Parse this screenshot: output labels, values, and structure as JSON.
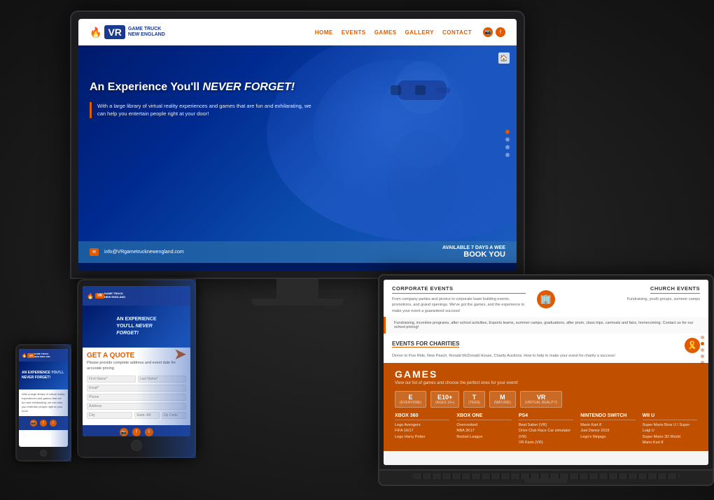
{
  "brand": {
    "name": "VR Game Truck New England",
    "logo_vr": "VR",
    "logo_tagline1": "GAME TRUCK",
    "logo_tagline2": "NEW ENGLAND"
  },
  "nav": {
    "links": [
      "HOME",
      "EVENTS",
      "GAMES",
      "GALLERY",
      "CONTACT"
    ]
  },
  "hero": {
    "title_prefix": "An Experience You'll ",
    "title_emphasis": "NEVER FORGET!",
    "body": "With a large library of virtual reality experiences and games that are fun and exhilarating, we can help you entertain people right at your door!"
  },
  "footer_bar": {
    "email": "info@VRgametrucknewengland.com",
    "available": "AVAILABLE 7 DAYS A WEE",
    "book": "BOOK YOU"
  },
  "events": {
    "corporate": {
      "title": "CORPORATE EVENTS",
      "text": "From company parties and picnics to corporate team building events, promotions, and grand openings.\n\nWe've got the games, and the experience to make your event a guaranteed success!"
    },
    "church": {
      "title": "CHURCH EVENTS",
      "text": "Fundraising, youth groups, summer camps"
    },
    "charities": {
      "title": "EVENTS FOR CHARITIES",
      "text": "Dinner to Five Ride, New Peach, Ronald McDonald House, Charity Auctions.\n\nHow to help to make your event for charity a success!"
    },
    "school": {
      "text": "Fundraising, incentive programs, after school activities, Esports teams, summer camps, graduations, after prom, class trips, carnivals and fairs, homecoming.\n\nContact us for our school pricing!"
    }
  },
  "games": {
    "section_title": "GAMES",
    "subtitle": "View our list of games and choose the perfect ones for your event!",
    "ratings": [
      {
        "letter": "E",
        "label": "(EVERYONE)"
      },
      {
        "letter": "E10+",
        "label": "(AGES 10+)"
      },
      {
        "letter": "T",
        "label": "(TEEN)"
      },
      {
        "letter": "M",
        "label": "(MATURE)"
      },
      {
        "letter": "VR",
        "label": "(VIRTUAL REALITY)"
      }
    ],
    "consoles": [
      {
        "name": "Xbox 360",
        "games": [
          "Lego Avengers",
          "FIFA 16/17",
          "Lego Harry Potter"
        ]
      },
      {
        "name": "Xbox One",
        "games": [
          "Overcooked",
          "NBA 2K17",
          "Rocket League"
        ]
      },
      {
        "name": "PS4",
        "games": [
          "Beat Saber (VR)",
          "Drive Club Race Car simulator (VR)",
          "VR Karts (VR)"
        ]
      },
      {
        "name": "Nintendo Switch",
        "games": [
          "Mario Kart 8",
          "Just Dance 2019",
          "Lego's Ninjago"
        ]
      },
      {
        "name": "Wii U",
        "games": [
          "Super Mario Bros U / Super Luigi U",
          "Super Mario 3D World",
          "Mario Kart 8"
        ]
      }
    ]
  },
  "quote_form": {
    "title": "GET A QUOTE",
    "subtitle": "Please provide complete address and event date for accurate pricing",
    "fields": [
      "First Name*",
      "Last Name*",
      "Email*",
      "Phone",
      "Address",
      "City",
      "State: AK",
      "Zip Code"
    ]
  },
  "phone_hero": {
    "text": "AN EXPERIENCE YOU'LL NEVER FORGET!"
  }
}
